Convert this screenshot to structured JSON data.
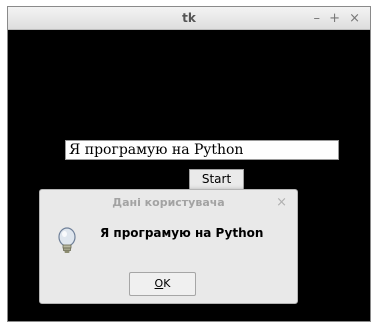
{
  "window": {
    "title": "tk",
    "minimize": "–",
    "maximize": "+",
    "close": "×"
  },
  "main": {
    "entry_value": "Я програмую на Python",
    "start_label": "Start"
  },
  "dialog": {
    "title": "Дані користувача",
    "close": "×",
    "message": "Я програмую на Python",
    "ok_mnemonic": "O",
    "ok_rest": "K",
    "icon": "lightbulb-icon"
  }
}
